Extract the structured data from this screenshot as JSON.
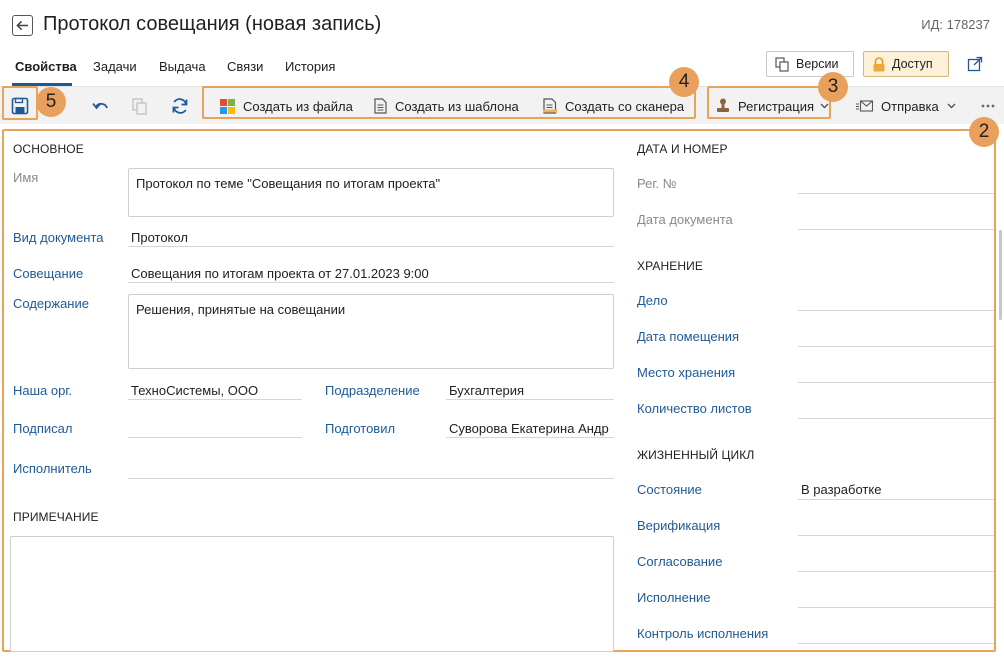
{
  "header": {
    "title": "Протокол совещания (новая запись)",
    "doc_id": "ИД: 178237"
  },
  "tabs": [
    {
      "label": "Свойства"
    },
    {
      "label": "Задачи"
    },
    {
      "label": "Выдача"
    },
    {
      "label": "Связи"
    },
    {
      "label": "История"
    }
  ],
  "top_buttons": {
    "versions": "Версии",
    "access": "Доступ"
  },
  "toolbar": {
    "create_from_file": "Создать из файла",
    "create_from_template": "Создать из шаблона",
    "create_from_scanner": "Создать со сканера",
    "registration": "Регистрация",
    "sending": "Отправка"
  },
  "badges": [
    "2",
    "3",
    "4",
    "5"
  ],
  "accent_color": "#e8a35a",
  "link_color": "#1f5a96",
  "left": {
    "section_main": "ОСНОВНОЕ",
    "name_label": "Имя",
    "name_value": "Протокол по теме \"Совещания по итогам проекта\"",
    "doc_type_label": "Вид документа",
    "doc_type_value": "Протокол",
    "meeting_label": "Совещание",
    "meeting_value": "Совещания по итогам проекта от 27.01.2023 9:00",
    "content_label": "Содержание",
    "content_value": "Решения, принятые на совещании",
    "our_org_label": "Наша орг.",
    "our_org_value": "ТехноСистемы, ООО",
    "department_label": "Подразделение",
    "department_value": "Бухгалтерия",
    "signed_label": "Подписал",
    "signed_value": "",
    "prepared_label": "Подготовил",
    "prepared_value": "Суворова Екатерина Андр",
    "executor_label": "Исполнитель",
    "executor_value": "",
    "section_note": "ПРИМЕЧАНИЕ",
    "note_value": ""
  },
  "right": {
    "section_date": "ДАТА И НОМЕР",
    "reg_no_label": "Рег. №",
    "doc_date_label": "Дата документа",
    "section_storage": "ХРАНЕНИЕ",
    "case_label": "Дело",
    "placement_date_label": "Дата помещения",
    "storage_place_label": "Место хранения",
    "sheets_label": "Количество листов",
    "section_lifecycle": "ЖИЗНЕННЫЙ ЦИКЛ",
    "state_label": "Состояние",
    "state_value": "В разработке",
    "verification_label": "Верификация",
    "approval_label": "Согласование",
    "execution_label": "Исполнение",
    "execution_control_label": "Контроль исполнения"
  }
}
